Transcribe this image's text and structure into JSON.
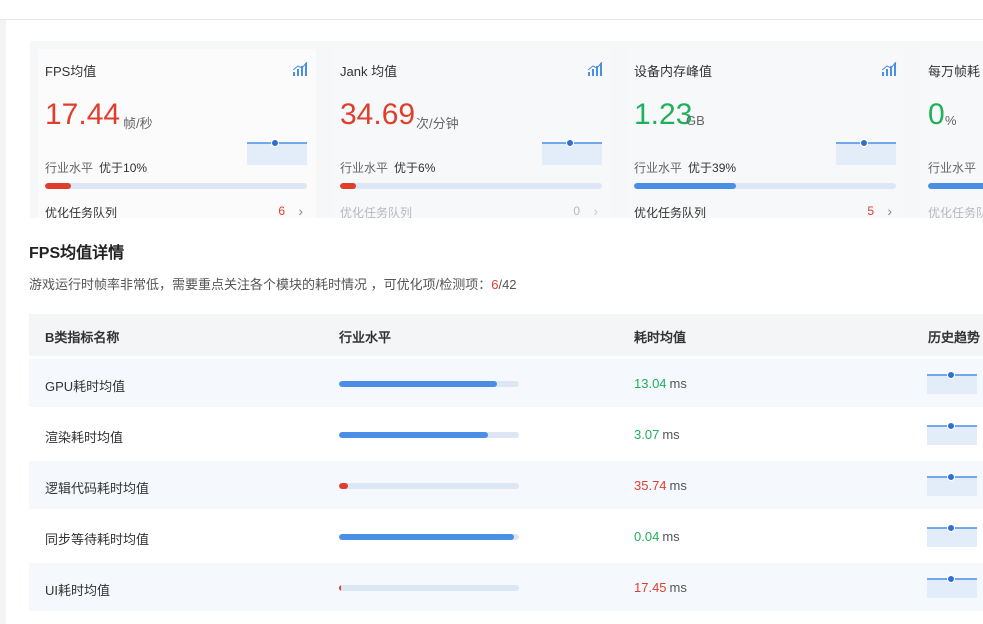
{
  "colors": {
    "red": "#e03e2d",
    "green": "#1fb05a",
    "blue": "#4a8ee6",
    "track": "#dde6f5"
  },
  "cards": [
    {
      "title": "FPS均值",
      "value": "17.44",
      "unit": "帧/秒",
      "value_color": "#e03e2d",
      "level_label": "行业水平",
      "level_text": "优于10%",
      "level_percent": 10,
      "bar_color": "#e03e2d",
      "queue_label": "优化任务队列",
      "queue_count": "6",
      "queue_count_color": "#e03e2d",
      "muted": false,
      "icon": "signal-bars-icon"
    },
    {
      "title": "Jank 均值",
      "value": "34.69",
      "unit": "次/分钟",
      "value_color": "#e03e2d",
      "level_label": "行业水平",
      "level_text": "优于6%",
      "level_percent": 6,
      "bar_color": "#e03e2d",
      "queue_label": "优化任务队列",
      "queue_count": "0",
      "queue_count_color": "#b5b8bd",
      "muted": true,
      "icon": "signal-bars-icon"
    },
    {
      "title": "设备内存峰值",
      "value": "1.23",
      "unit": "GB",
      "value_color": "#1fb05a",
      "level_label": "行业水平",
      "level_text": "优于39%",
      "level_percent": 39,
      "bar_color": "#4a8ee6",
      "queue_label": "优化任务队列",
      "queue_count": "5",
      "queue_count_color": "#e03e2d",
      "muted": false,
      "icon": "signal-bars-icon"
    },
    {
      "title": "每万帧耗",
      "value": "0",
      "unit": "%",
      "value_color": "#1fb05a",
      "level_label": "行业水平",
      "level_text": "",
      "level_percent": 100,
      "bar_color": "#4a8ee6",
      "queue_label": "优化任务队列",
      "queue_count": "",
      "queue_count_color": "#b5b8bd",
      "muted": true,
      "icon": "signal-bars-icon"
    }
  ],
  "section": {
    "title": "FPS均值详情",
    "desc_prefix": "游戏运行时帧率非常低，需要重点关注各个模块的耗时情况 ，可优化项/检测项：",
    "desc_optimizable": "6",
    "desc_total": "/42"
  },
  "table": {
    "headers": [
      "B类指标名称",
      "行业水平",
      "耗时均值",
      "历史趋势"
    ],
    "rows": [
      {
        "name": "GPU耗时均值",
        "percent": 88,
        "bar_color": "#4a8ee6",
        "value": "13.04",
        "unit": "ms",
        "value_color": "#1fb05a"
      },
      {
        "name": "渲染耗时均值",
        "percent": 83,
        "bar_color": "#4a8ee6",
        "value": "3.07",
        "unit": "ms",
        "value_color": "#1fb05a"
      },
      {
        "name": "逻辑代码耗时均值",
        "percent": 5,
        "bar_color": "#e03e2d",
        "value": "35.74",
        "unit": "ms",
        "value_color": "#e03e2d"
      },
      {
        "name": "同步等待耗时均值",
        "percent": 97,
        "bar_color": "#4a8ee6",
        "value": "0.04",
        "unit": "ms",
        "value_color": "#1fb05a"
      },
      {
        "name": "UI耗时均值",
        "percent": 1,
        "bar_color": "#e03e2d",
        "value": "17.45",
        "unit": "ms",
        "value_color": "#e03e2d"
      }
    ]
  }
}
